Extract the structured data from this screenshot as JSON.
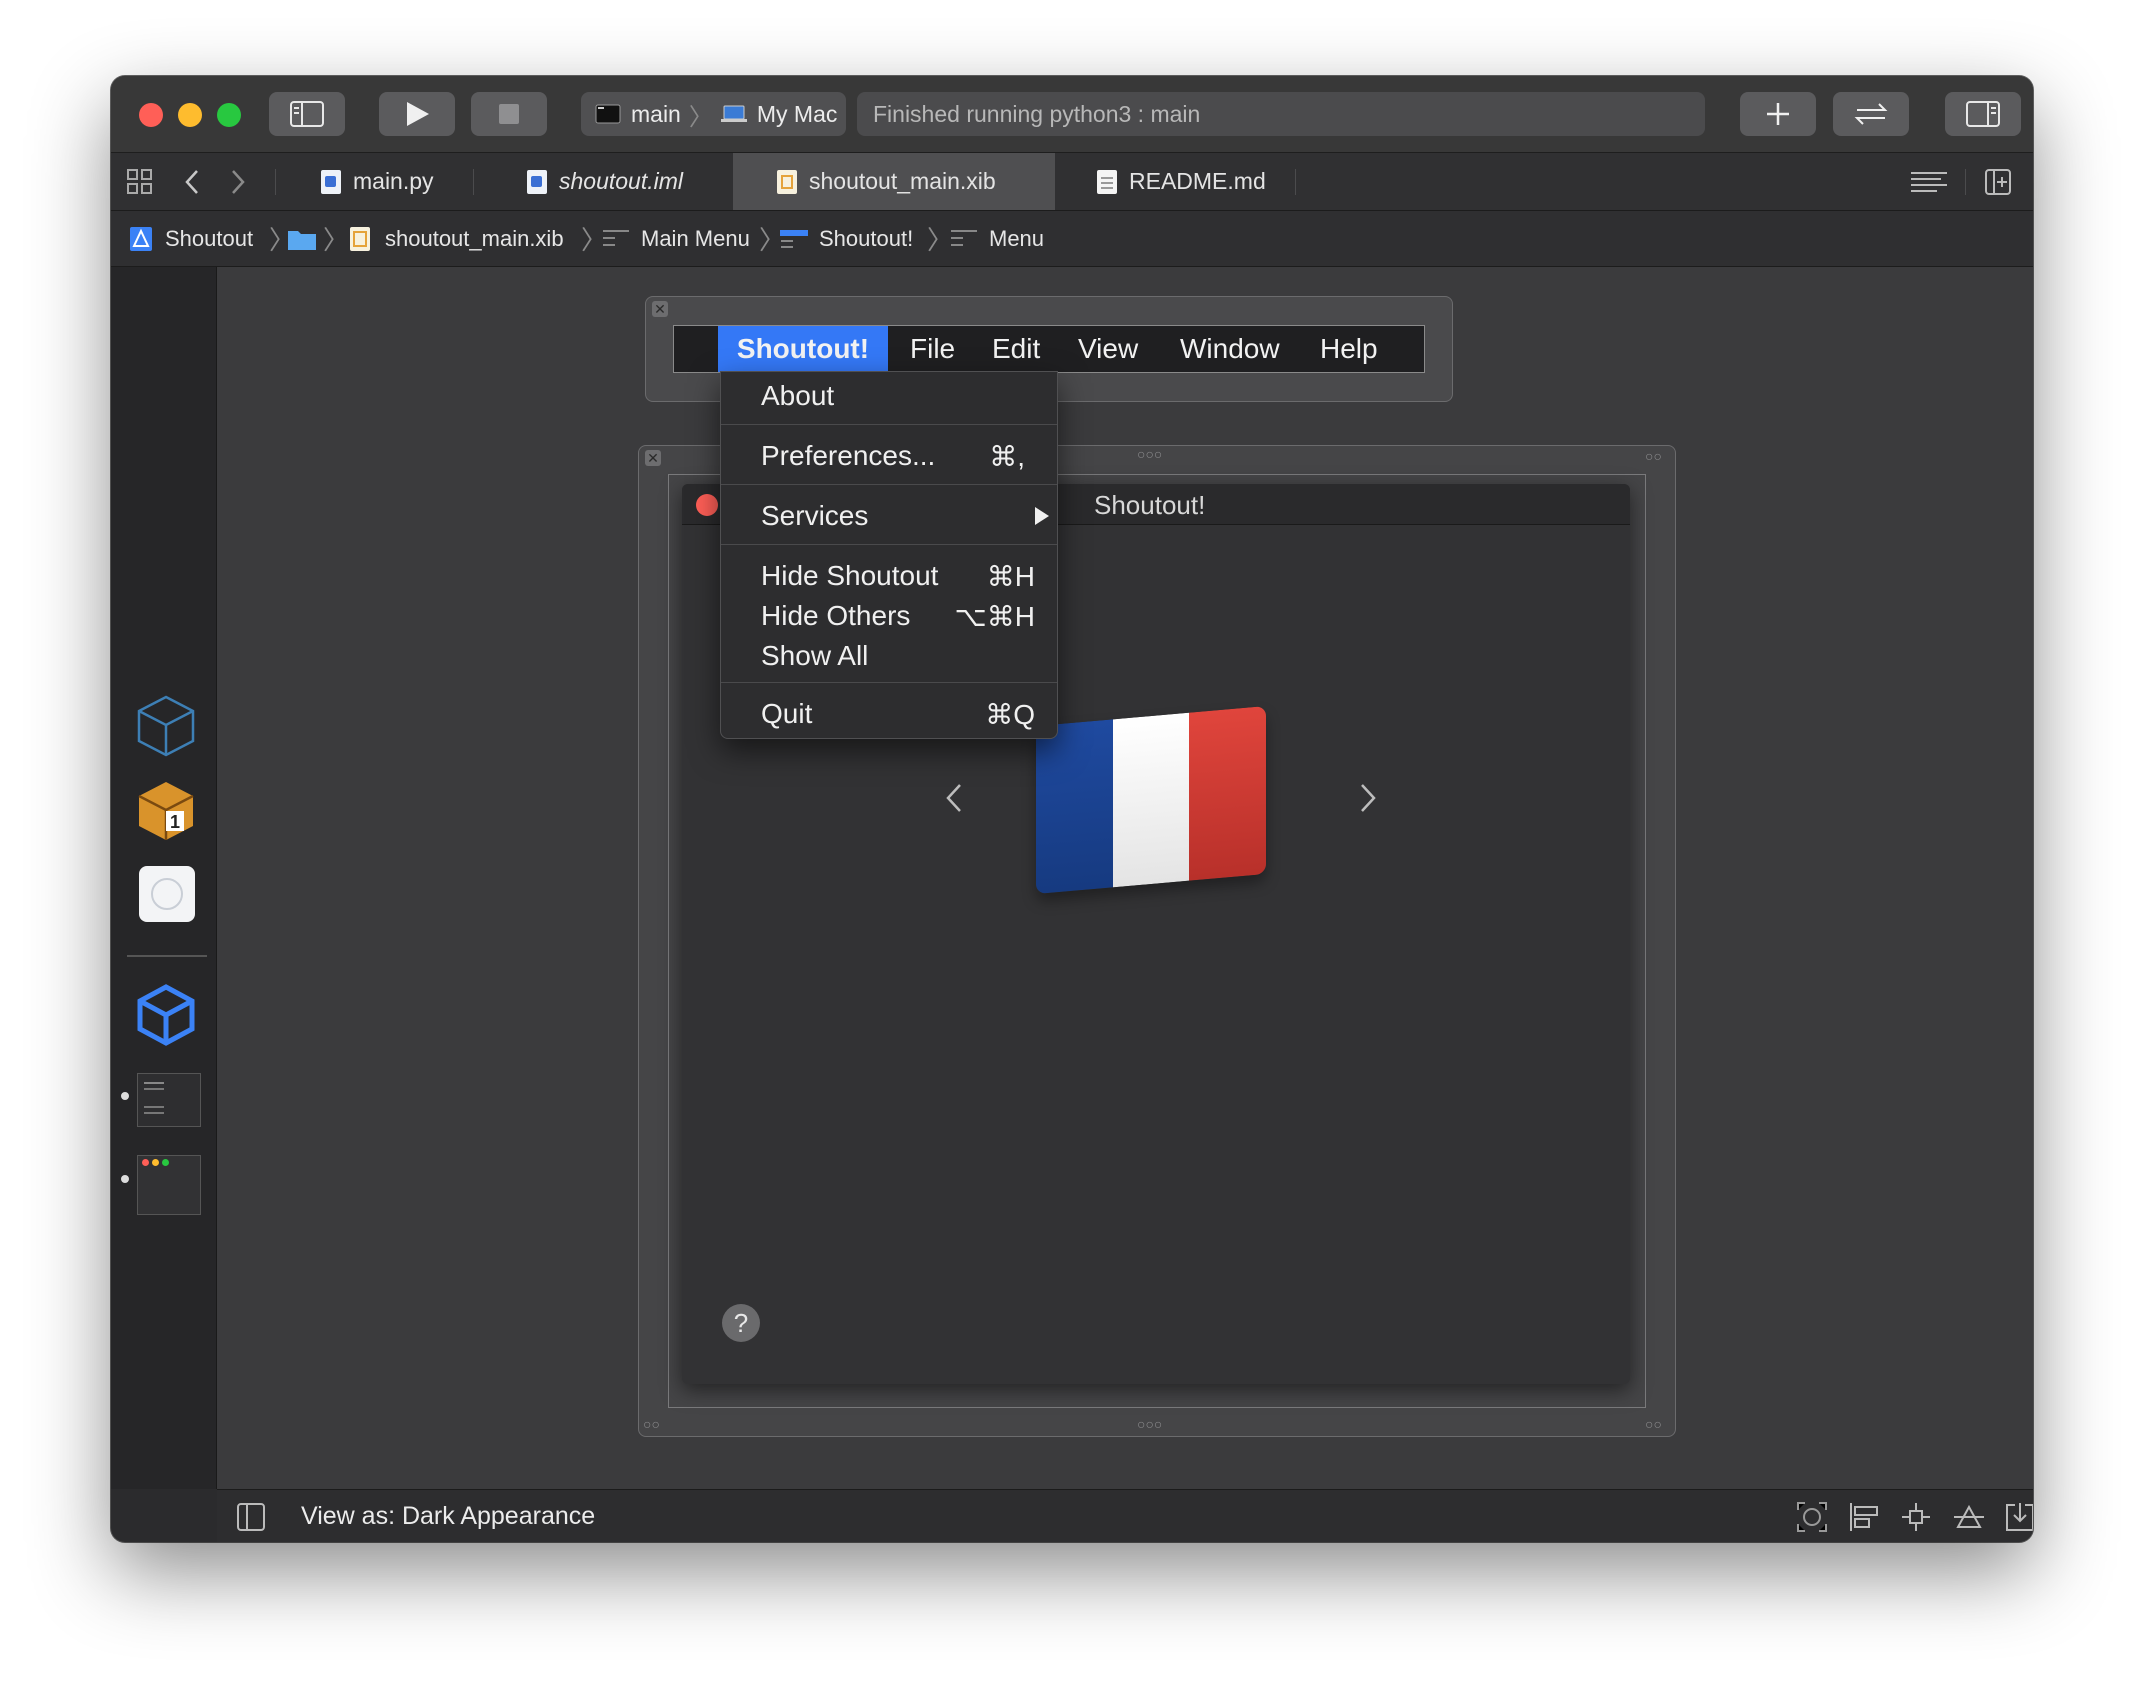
{
  "toolbar": {
    "scheme_target": "main",
    "scheme_device": "My Mac",
    "status_text": "Finished running python3 : main"
  },
  "tabs": [
    {
      "label": "main.py"
    },
    {
      "label": "shoutout.iml"
    },
    {
      "label": "shoutout_main.xib"
    },
    {
      "label": "README.md"
    }
  ],
  "jumpbar": {
    "project": "Shoutout",
    "file": "shoutout_main.xib",
    "main_menu": "Main Menu",
    "app_item": "Shoutout!",
    "menu": "Menu"
  },
  "menubar": {
    "items": [
      "Shoutout!",
      "File",
      "Edit",
      "View",
      "Window",
      "Help"
    ]
  },
  "app_menu": {
    "about": "About",
    "preferences": "Preferences...",
    "preferences_shortcut": "⌘,",
    "services": "Services",
    "hide": "Hide Shoutout",
    "hide_shortcut": "⌘H",
    "hide_others": "Hide Others",
    "hide_others_shortcut": "⌥⌘H",
    "show_all": "Show All",
    "quit": "Quit",
    "quit_shortcut": "⌘Q"
  },
  "app_window": {
    "title": "Shoutout!",
    "help": "?"
  },
  "bottom_bar": {
    "view_as": "View as: Dark Appearance"
  },
  "colors": {
    "accent": "#3478f6",
    "close": "#ff5f57",
    "minimize": "#febc2e",
    "zoom": "#28c840"
  }
}
